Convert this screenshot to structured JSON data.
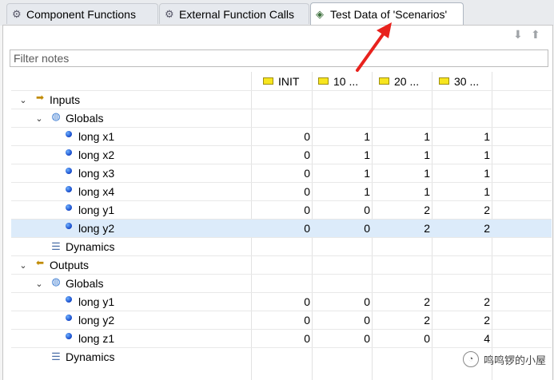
{
  "tabs": [
    {
      "label": "Component Functions",
      "icon": "gear-icon"
    },
    {
      "label": "External Function Calls",
      "icon": "external-call-icon"
    },
    {
      "label": "Test Data of 'Scenarios'",
      "icon": "test-data-icon",
      "active": true
    }
  ],
  "toolbar": {
    "icons": [
      "move-down-icon",
      "move-up-icon"
    ]
  },
  "filter": {
    "placeholder": "Filter notes",
    "value": ""
  },
  "columns": [
    "INIT",
    "10 ...",
    "20 ...",
    "30 ..."
  ],
  "rows": [
    {
      "label": "Inputs",
      "icon": "input-arrow-icon",
      "level": 0,
      "expanded": true,
      "values": []
    },
    {
      "label": "Globals",
      "icon": "globals-icon",
      "level": 1,
      "expanded": true,
      "values": []
    },
    {
      "label": "long x1",
      "icon": "variable-dot-icon",
      "level": 2,
      "values": [
        "0",
        "1",
        "1",
        "1"
      ]
    },
    {
      "label": "long x2",
      "icon": "variable-dot-icon",
      "level": 2,
      "values": [
        "0",
        "1",
        "1",
        "1"
      ]
    },
    {
      "label": "long x3",
      "icon": "variable-dot-icon",
      "level": 2,
      "values": [
        "0",
        "1",
        "1",
        "1"
      ]
    },
    {
      "label": "long x4",
      "icon": "variable-dot-icon",
      "level": 2,
      "values": [
        "0",
        "1",
        "1",
        "1"
      ]
    },
    {
      "label": "long y1",
      "icon": "variable-dot-icon",
      "level": 2,
      "values": [
        "0",
        "0",
        "2",
        "2"
      ]
    },
    {
      "label": "long y2",
      "icon": "variable-dot-icon",
      "level": 2,
      "values": [
        "0",
        "0",
        "2",
        "2"
      ],
      "selected": true
    },
    {
      "label": "Dynamics",
      "icon": "dynamics-icon",
      "level": 1,
      "values": []
    },
    {
      "label": "Outputs",
      "icon": "output-arrow-icon",
      "level": 0,
      "expanded": true,
      "values": []
    },
    {
      "label": "Globals",
      "icon": "globals-icon",
      "level": 1,
      "expanded": true,
      "values": []
    },
    {
      "label": "long y1",
      "icon": "variable-dot-icon",
      "level": 2,
      "values": [
        "0",
        "0",
        "2",
        "2"
      ]
    },
    {
      "label": "long y2",
      "icon": "variable-dot-icon",
      "level": 2,
      "values": [
        "0",
        "0",
        "2",
        "2"
      ]
    },
    {
      "label": "long z1",
      "icon": "variable-dot-icon",
      "level": 2,
      "values": [
        "0",
        "0",
        "0",
        "4"
      ]
    },
    {
      "label": "Dynamics",
      "icon": "dynamics-icon",
      "level": 1,
      "values": []
    }
  ],
  "watermark": {
    "text": "鸣鸣锣的小屋"
  },
  "colors": {
    "selection": "#dcebfa",
    "annotation_arrow": "#e8221d",
    "column_tag": "#f7e51f"
  }
}
